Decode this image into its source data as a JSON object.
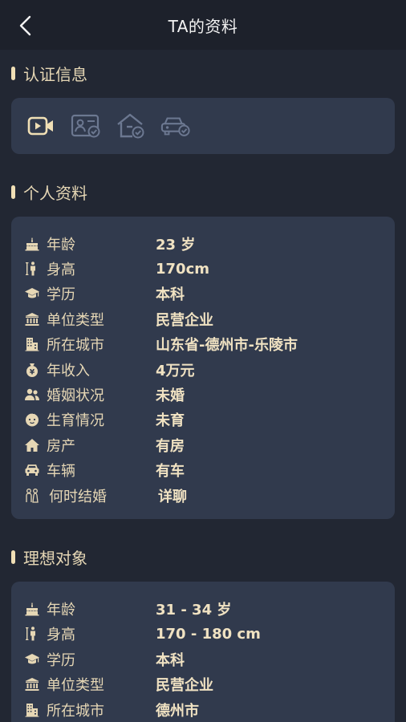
{
  "header": {
    "title": "TA的资料",
    "back_icon": "chevron-left-icon"
  },
  "colors": {
    "background": "#222733",
    "header": "#1d212b",
    "card": "#313a4d",
    "gold": "#e6d7b5",
    "muted_icon": "#6c7891"
  },
  "certification": {
    "title": "认证信息",
    "icons": [
      {
        "name": "video-verify-icon",
        "active": true
      },
      {
        "name": "id-card-verify-icon",
        "active": false
      },
      {
        "name": "house-verify-icon",
        "active": false
      },
      {
        "name": "car-verify-icon",
        "active": false
      }
    ]
  },
  "personal": {
    "title": "个人资料",
    "rows": [
      {
        "icon": "cake-icon",
        "label": "年龄",
        "value": "23 岁"
      },
      {
        "icon": "height-icon",
        "label": "身高",
        "value": "170cm"
      },
      {
        "icon": "graduation-cap-icon",
        "label": "学历",
        "value": "本科"
      },
      {
        "icon": "building-columns-icon",
        "label": "单位类型",
        "value": "民营企业"
      },
      {
        "icon": "city-icon",
        "label": "所在城市",
        "value": "山东省-德州市-乐陵市"
      },
      {
        "icon": "money-bag-icon",
        "label": "年收入",
        "value": "4万元"
      },
      {
        "icon": "couple-icon",
        "label": "婚姻状况",
        "value": "未婚"
      },
      {
        "icon": "baby-face-icon",
        "label": "生育情况",
        "value": "未育"
      },
      {
        "icon": "house-icon",
        "label": "房产",
        "value": "有房"
      },
      {
        "icon": "car-icon",
        "label": "车辆",
        "value": "有车"
      },
      {
        "icon": "bride-groom-icon",
        "label": "何时结婚",
        "value": "详聊"
      }
    ]
  },
  "ideal": {
    "title": "理想对象",
    "rows": [
      {
        "icon": "cake-icon",
        "label": "年龄",
        "value": "31 - 34 岁"
      },
      {
        "icon": "height-icon",
        "label": "身高",
        "value": "170 - 180 cm"
      },
      {
        "icon": "graduation-cap-icon",
        "label": "学历",
        "value": "本科"
      },
      {
        "icon": "building-columns-icon",
        "label": "单位类型",
        "value": "民营企业"
      },
      {
        "icon": "city-icon",
        "label": "所在城市",
        "value": "德州市"
      }
    ]
  }
}
